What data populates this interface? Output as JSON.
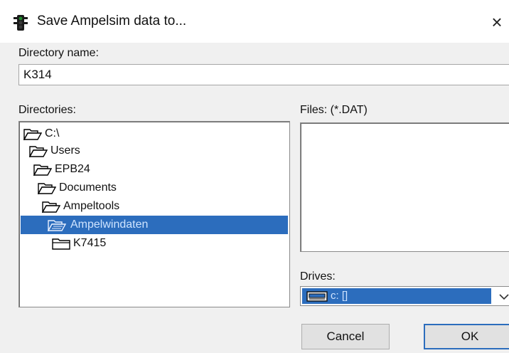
{
  "window": {
    "title": "Save Ampelsim data to...",
    "close_symbol": "×",
    "app_icon": "traffic-light-icon"
  },
  "directory_name": {
    "label": "Directory name:",
    "value": "K314"
  },
  "directories": {
    "label": "Directories:",
    "items": [
      {
        "label": "C:\\",
        "icon": "open-folder-icon",
        "selected": false
      },
      {
        "label": "Users",
        "icon": "open-folder-icon",
        "selected": false
      },
      {
        "label": "EPB24",
        "icon": "open-folder-icon",
        "selected": false
      },
      {
        "label": "Documents",
        "icon": "open-folder-icon",
        "selected": false
      },
      {
        "label": "Ampeltools",
        "icon": "open-folder-icon",
        "selected": false
      },
      {
        "label": "Ampelwindaten",
        "icon": "open-folder-icon",
        "selected": true
      },
      {
        "label": "K7415",
        "icon": "closed-folder-icon",
        "selected": false
      }
    ]
  },
  "files": {
    "label": "Files: (*.DAT)",
    "items": []
  },
  "drives": {
    "label": "Drives:",
    "selected": "c: []",
    "icon": "drive-icon"
  },
  "buttons": {
    "cancel": "Cancel",
    "ok": "OK"
  },
  "colors": {
    "selection": "#2c6dbd",
    "selection_text": "#cfe4ff",
    "background": "#f0f0f0"
  }
}
